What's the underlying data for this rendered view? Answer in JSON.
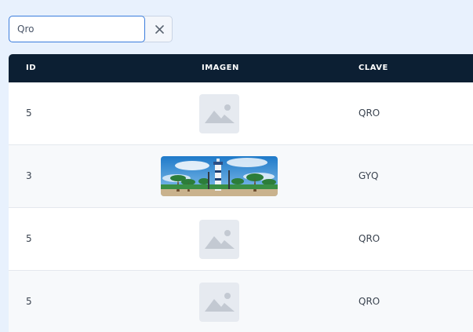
{
  "search": {
    "value": "Qro",
    "clear_icon": "close-icon"
  },
  "table": {
    "headers": {
      "id": "ID",
      "image": "IMAGEN",
      "key": "CLAVE"
    },
    "rows": [
      {
        "id": "5",
        "image": "placeholder-image-icon",
        "key": "QRO"
      },
      {
        "id": "3",
        "image": "photo-lighthouse-palms",
        "key": "GYQ"
      },
      {
        "id": "5",
        "image": "placeholder-image-icon",
        "key": "QRO"
      },
      {
        "id": "5",
        "image": "placeholder-image-icon",
        "key": "QRO"
      }
    ]
  },
  "colors": {
    "header_bg": "#0c1f33",
    "page_bg": "#e8f1fd",
    "focus_border": "#3b7ddd"
  }
}
